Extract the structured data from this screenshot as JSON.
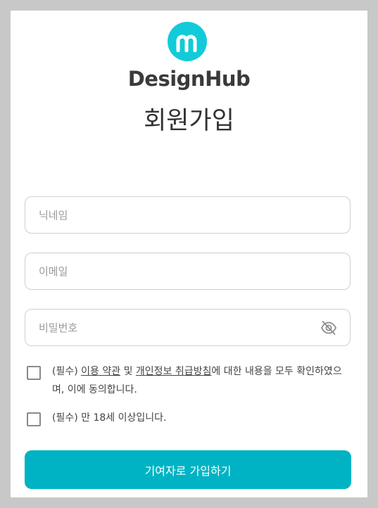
{
  "brand": {
    "logo_letter": "m",
    "name": "DesignHub",
    "accent_color": "#12cbd8"
  },
  "page_title": "회원가입",
  "form": {
    "nickname": {
      "placeholder": "닉네임",
      "value": ""
    },
    "email": {
      "placeholder": "이메일",
      "value": ""
    },
    "password": {
      "placeholder": "비밀번호",
      "value": "",
      "toggle_icon": "eye-off-icon"
    }
  },
  "agreements": {
    "terms": {
      "checked": false,
      "prefix": "(필수) ",
      "terms_link": "이용 약관",
      "and": " 및 ",
      "privacy_link": "개인정보 취급방침",
      "suffix": "에 대한 내용을 모두 확인하였으며, 이에 동의합니다."
    },
    "age": {
      "checked": false,
      "text": "(필수) 만 18세 이상입니다."
    }
  },
  "submit": {
    "label": "기여자로 가입하기",
    "color": "#00b3c4"
  }
}
